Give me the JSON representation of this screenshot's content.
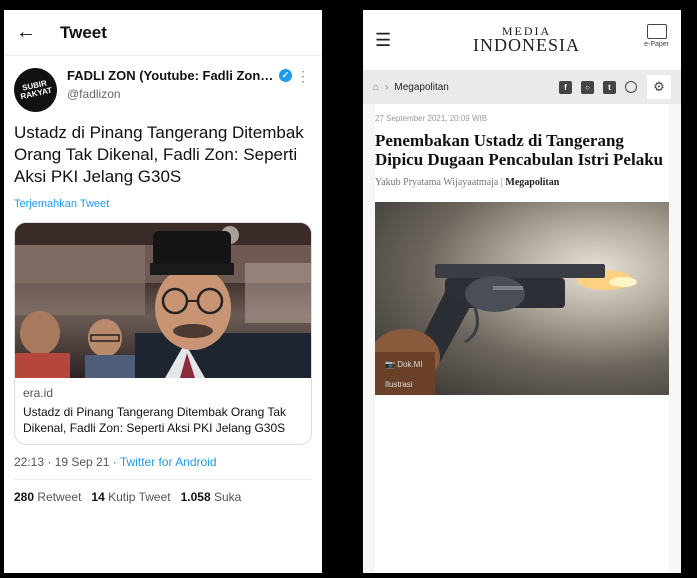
{
  "twitter": {
    "header_title": "Tweet",
    "author": {
      "avatar_text_top": "SUBIR",
      "avatar_text_bottom": "RAKYAT",
      "name": "FADLI ZON (Youtube: Fadli Zon O...",
      "handle": "@fadlizon"
    },
    "tweet_text": "Ustadz di Pinang Tangerang Ditembak Orang Tak Dikenal, Fadli Zon: Seperti Aksi PKI Jelang G30S",
    "translate_label": "Terjemahkan Tweet",
    "card": {
      "domain": "era.id",
      "title": "Ustadz di Pinang Tangerang Ditembak Orang Tak Dikenal, Fadli Zon: Seperti Aksi PKI Jelang G30S"
    },
    "time": "22:13 · 19 Sep 21 · ",
    "source": "Twitter for Android",
    "stats": {
      "retweet_count": "280",
      "retweet_label": "Retweet",
      "quote_count": "14",
      "quote_label": "Kutip Tweet",
      "like_count": "1.058",
      "like_label": "Suka"
    }
  },
  "media_indonesia": {
    "logo_line1": "MEDIA",
    "logo_line2": "INDONESIA",
    "epaper_label": "e-Paper",
    "breadcrumb": "Megapolitan",
    "date": "27 September 2021, 20:09 WIB",
    "headline": "Penembakan Ustadz di Tangerang Dipicu Dugaan Pencabulan Istri Pelaku",
    "author": "Yakub Pryatama Wijayaatmaja",
    "byline_sep": " | ",
    "category": "Megapolitan",
    "photo_credit": "Dok.MI",
    "photo_caption": "Ilustrasi"
  },
  "colors": {
    "twitter_blue": "#1d9bf0",
    "background": "#000000"
  }
}
